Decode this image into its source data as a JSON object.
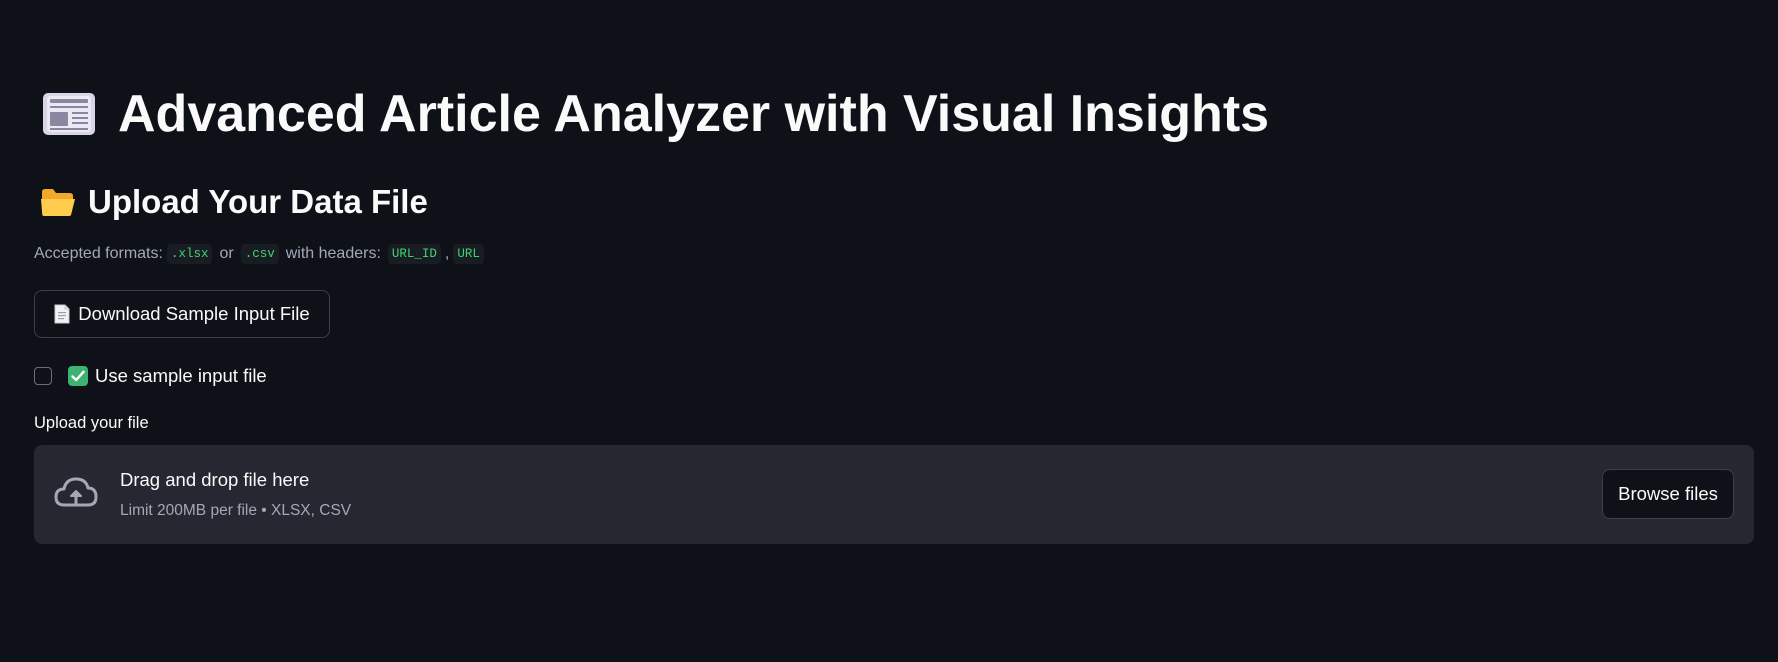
{
  "header": {
    "title": "Advanced Article Analyzer with Visual Insights",
    "title_icon": "newspaper-icon"
  },
  "upload_section": {
    "subheader": "Upload Your Data File",
    "subheader_icon": "open-folder-icon",
    "caption": {
      "prefix": "Accepted formats:",
      "format1": ".xlsx",
      "or": "or",
      "format2": ".csv",
      "with_headers": "with headers:",
      "header1": "URL_ID",
      "comma": ",",
      "header2": "URL"
    },
    "download_button": {
      "label": "Download Sample Input File",
      "icon": "page-icon"
    },
    "checkbox": {
      "label": "Use sample input file",
      "checked": false,
      "icon": "check-mark-button-icon"
    },
    "uploader": {
      "label": "Upload your file",
      "drop_text": "Drag and drop file here",
      "limit_text": "Limit 200MB per file • XLSX, CSV",
      "browse_label": "Browse files",
      "icon": "cloud-upload-icon"
    }
  },
  "colors": {
    "background": "#0e1117",
    "text": "#fafafa",
    "muted": "#a3a8b8",
    "code": "#3dd56d",
    "dropzone": "#262730",
    "border": "#3b3f4a",
    "check_green": "#3cb371"
  }
}
